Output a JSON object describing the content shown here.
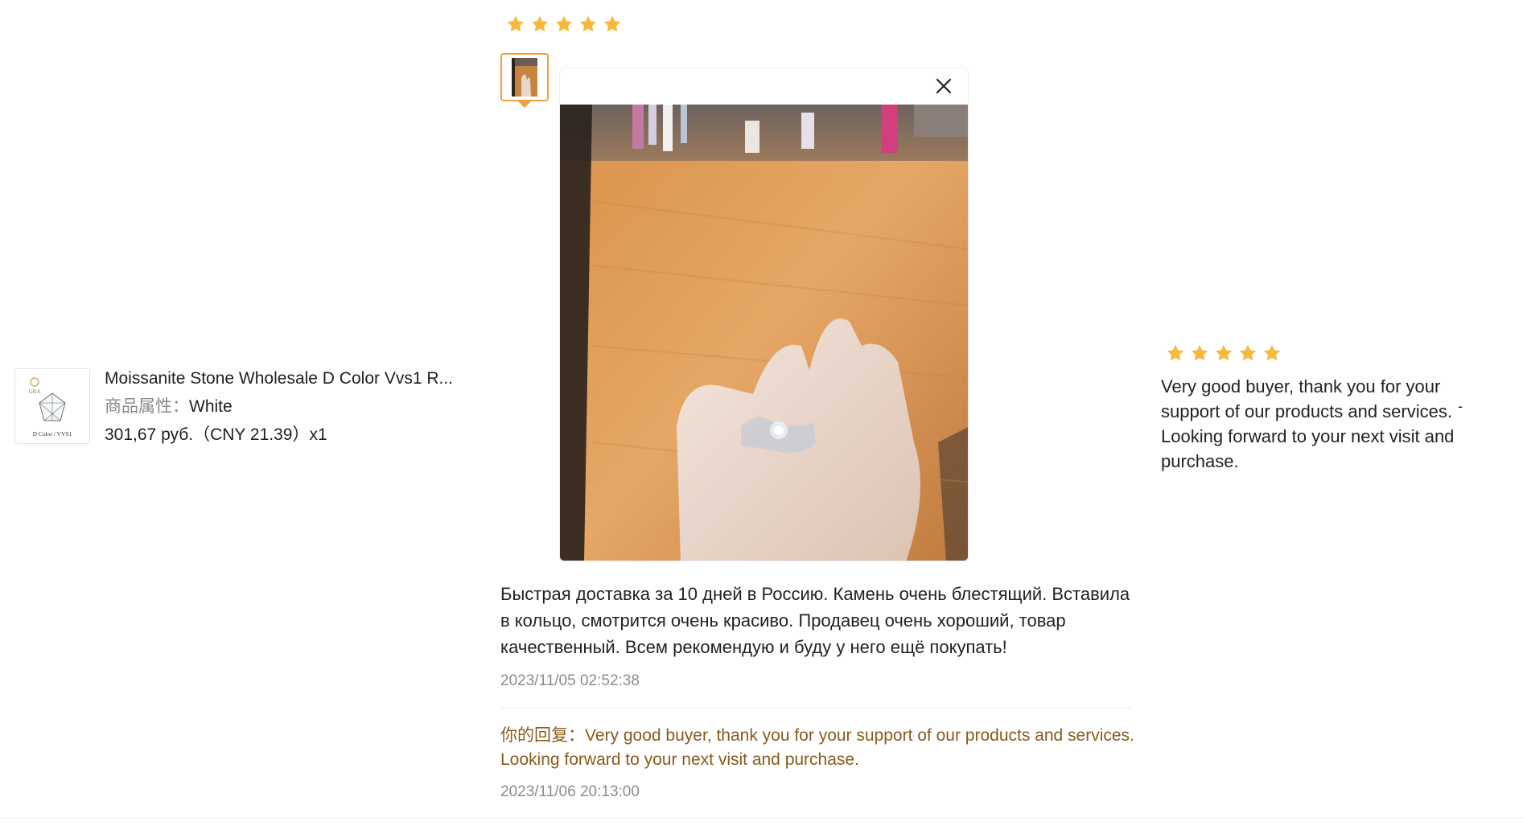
{
  "review": {
    "rating": 5,
    "text": "Быстрая доставка за 10 дней в Россию. Камень очень блестящий. Вставила в кольцо, смотрится очень красиво. Продавец очень хороший, товар качественный. Всем рекомендую и буду у него ещё покупать!",
    "date": "2023/11/05 02:52:38",
    "reply_label": "你的回复：",
    "reply_text": "Very good buyer, thank you for your support of our products and services. Looking forward to your next visit and purchase.",
    "reply_date": "2023/11/06 20:13:00"
  },
  "product": {
    "title": "Moissanite Stone Wholesale D Color Vvs1 R...",
    "attr_label": "商品属性：",
    "attr_value": "White",
    "price_line": "301,67 руб.（CNY  21.39）x1",
    "thumb_caption": "D Color / VVS1",
    "thumb_logo": "GRA"
  },
  "seller_feedback": {
    "rating": 5,
    "text": "Very good buyer, thank you for your support of our products and services. Looking forward to your next visit and purchase.",
    "trailing_mark": "-"
  },
  "colors": {
    "star": "#f6b93b",
    "accent_border": "#f0a23a",
    "reply": "#8a5a1e",
    "muted": "#8c8c8c"
  },
  "icons": [
    "star-icon",
    "close-icon"
  ]
}
